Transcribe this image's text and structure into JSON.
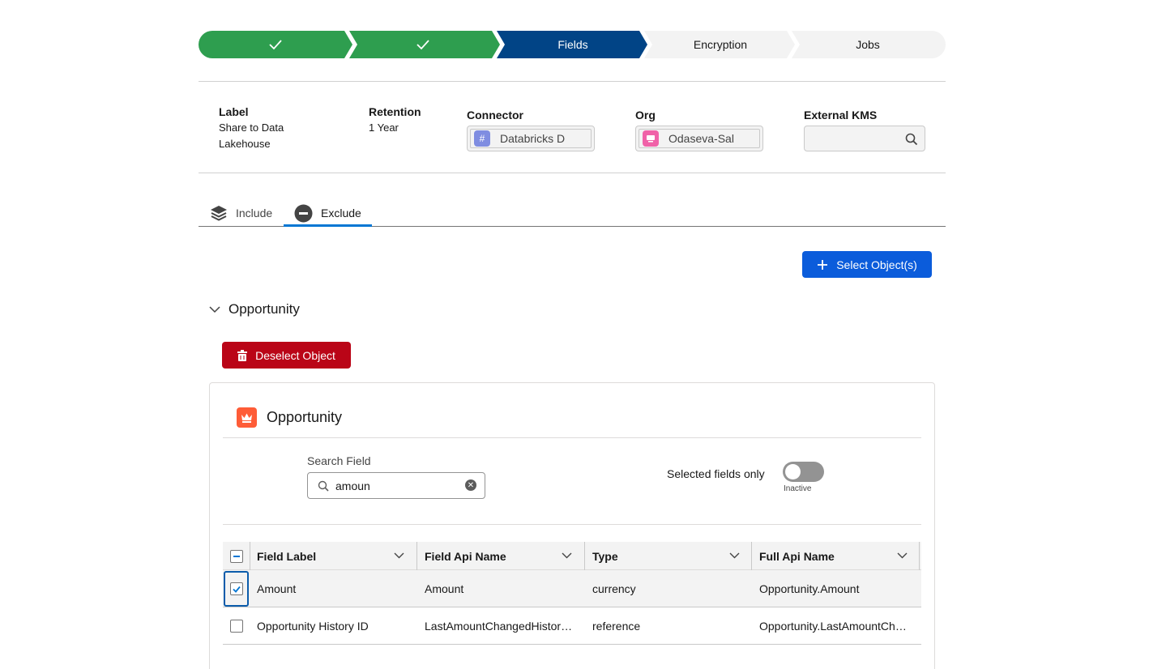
{
  "path": {
    "stages": [
      {
        "label": "",
        "state": "complete"
      },
      {
        "label": "",
        "state": "complete"
      },
      {
        "label": "Fields",
        "state": "current"
      },
      {
        "label": "Encryption",
        "state": "incomplete"
      },
      {
        "label": "Jobs",
        "state": "incomplete"
      }
    ],
    "colors": {
      "complete": "#2e9e4f",
      "current": "#014486",
      "incomplete": "#f3f3f3"
    }
  },
  "header": {
    "label_title": "Label",
    "label_line1": "Share to Data",
    "label_line2": "Lakehouse",
    "retention_title": "Retention",
    "retention_value": "1 Year",
    "connector_title": "Connector",
    "connector_value": "Databricks D",
    "org_title": "Org",
    "org_value": "Odaseva-Sal",
    "kms_title": "External KMS",
    "kms_value": ""
  },
  "tabs": {
    "include": "Include",
    "exclude": "Exclude",
    "active": "Exclude"
  },
  "actions": {
    "select_objects": "Select Object(s)",
    "deselect_object": "Deselect Object"
  },
  "section": {
    "title": "Opportunity"
  },
  "card": {
    "title": "Opportunity",
    "search_label": "Search Field",
    "search_value": "amoun",
    "toggle_label": "Selected fields only",
    "toggle_state": "Inactive",
    "toggle_on": false
  },
  "table": {
    "columns": [
      "Field Label",
      "Field Api Name",
      "Type",
      "Full Api Name"
    ],
    "rows": [
      {
        "checked": true,
        "label": "Amount",
        "api": "Amount",
        "type": "currency",
        "full": "Opportunity.Amount"
      },
      {
        "checked": false,
        "label": "Opportunity History ID",
        "api": "LastAmountChangedHistor…",
        "type": "reference",
        "full": "Opportunity.LastAmountCh…"
      }
    ]
  }
}
